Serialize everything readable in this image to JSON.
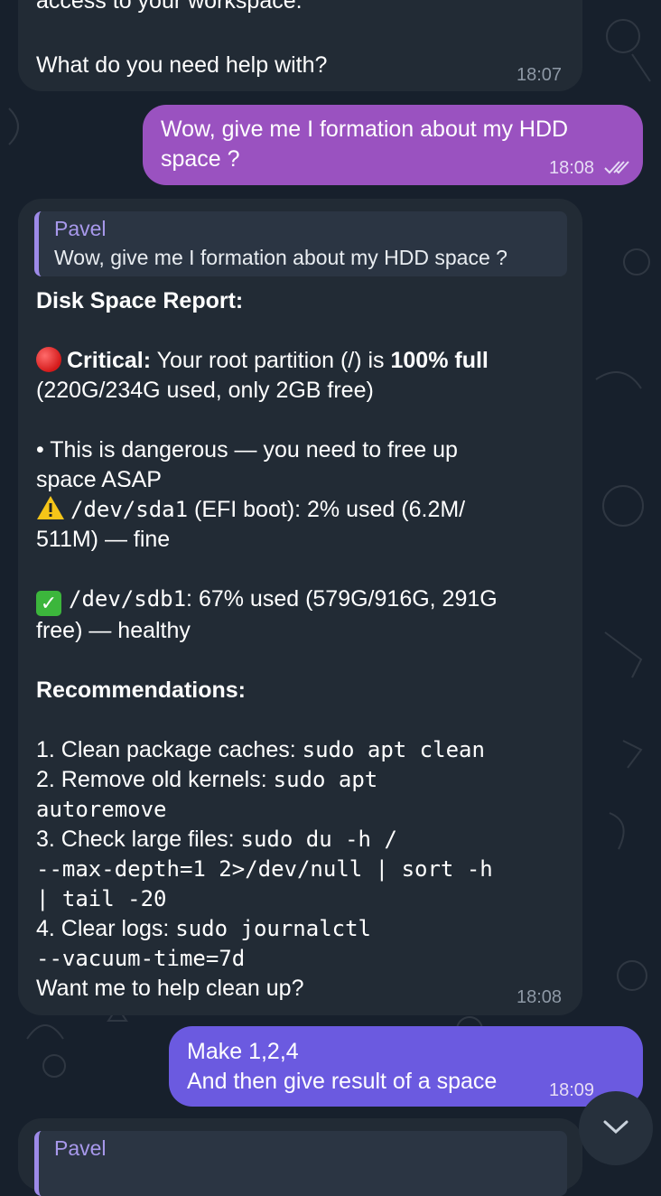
{
  "messages": {
    "m1": {
      "partial_text": "access to your workspace.",
      "question": "What do you need help with?",
      "time": "18:07"
    },
    "m2": {
      "text": "Wow, give me I formation about my HDD\nspace ?",
      "time": "18:08"
    },
    "m3": {
      "reply_name": "Pavel",
      "reply_text": "Wow, give me I formation about my HDD space ?",
      "heading": "Disk Space Report:",
      "critical_label": "Critical:",
      "critical_text_a": " Your root partition (/) is ",
      "critical_bold": "100% full",
      "critical_text_b": "(220G/234G used, only 2GB free)",
      "bullet": "• This is dangerous — you need to free up\nspace ASAP",
      "sda1_code": "/dev/sda1",
      "sda1_text_a": " (EFI boot): 2% used (6.2M/",
      "sda1_text_b": "511M) — fine",
      "sdb1_code": "/dev/sdb1",
      "sdb1_text_a": ": 67% used (579G/916G, 291G",
      "sdb1_text_b": "free) — healthy",
      "recommendations": "Recommendations:",
      "r1_text": "1. Clean package caches: ",
      "r1_code": "sudo apt clean",
      "r2_text": "2. Remove old kernels: ",
      "r2_code_a": "sudo apt",
      "r2_code_b": "autoremove",
      "r3_text": "3. Check large files: ",
      "r3_code_a": "sudo du -h /",
      "r3_code_b": "--max-depth=1 2>/dev/null | sort -h",
      "r3_code_c": "| tail -20",
      "r4_text": "4. Clear logs: ",
      "r4_code_a": "sudo journalctl",
      "r4_code_b": "--vacuum-time=7d",
      "closing": "Want me to help clean up?",
      "time": "18:08"
    },
    "m4": {
      "line1": "Make 1,2,4",
      "line2": "And then give result of a space",
      "time": "18:09"
    },
    "m5": {
      "reply_name": "Pavel"
    }
  },
  "icons": {
    "read_receipt": "double-check-icon",
    "scroll_down": "chevron-down-icon"
  },
  "colors": {
    "background": "#17202c",
    "incoming": "#222b35",
    "outgoing_1": "#9a52c0",
    "outgoing_2": "#6b5ae0",
    "accent": "#9d8ae8"
  }
}
